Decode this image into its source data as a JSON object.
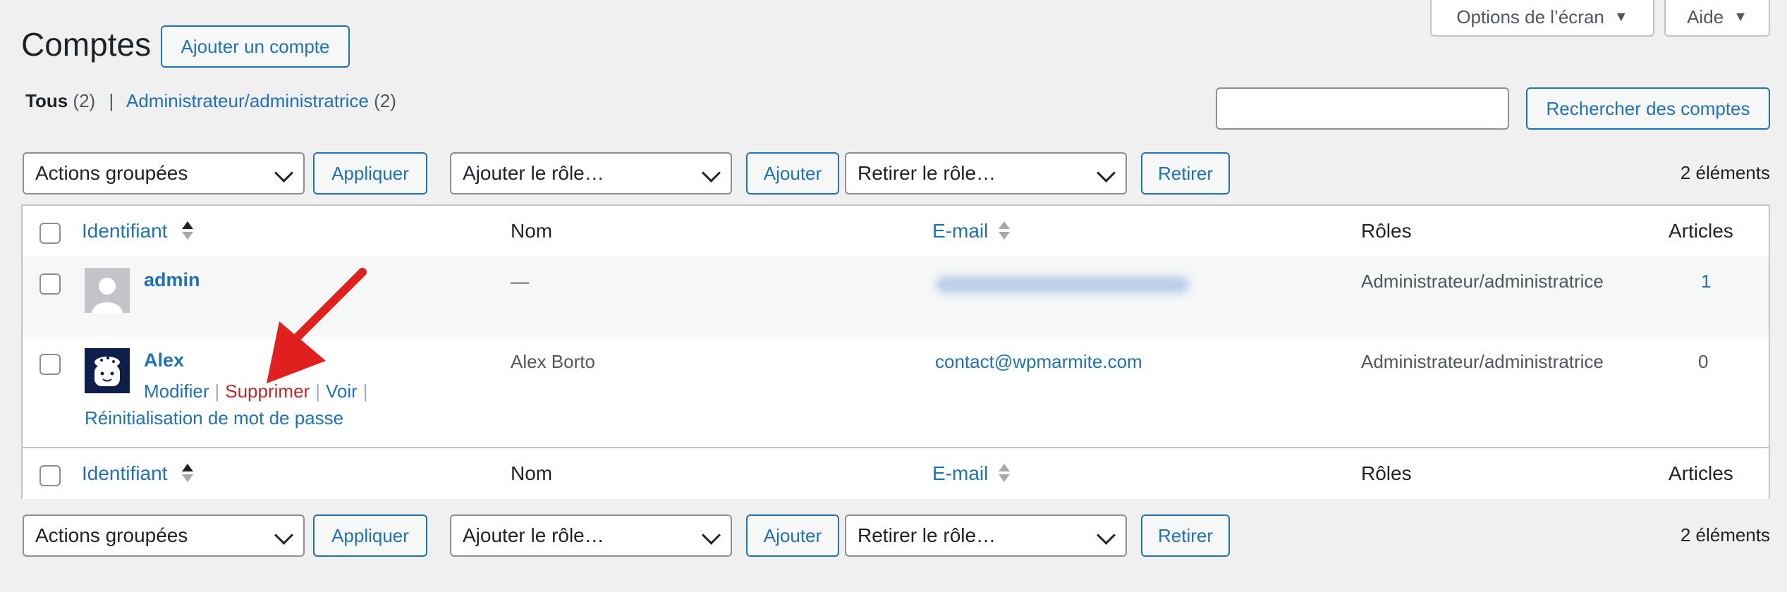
{
  "screen_meta": {
    "options_label": "Options de l’écran",
    "help_label": "Aide"
  },
  "page_title": "Comptes",
  "add_button_label": "Ajouter un compte",
  "views": {
    "all_label": "Tous",
    "all_count": "(2)",
    "separator": "|",
    "admin_label": "Administrateur/administratrice",
    "admin_count": "(2)"
  },
  "search": {
    "value": "",
    "button_label": "Rechercher des comptes"
  },
  "tablenav": {
    "bulk_actions": "Actions groupées",
    "apply": "Appliquer",
    "add_role": "Ajouter le rôle…",
    "add": "Ajouter",
    "remove_role": "Retirer le rôle…",
    "remove": "Retirer",
    "count": "2 éléments"
  },
  "columns": {
    "username": "Identifiant",
    "name": "Nom",
    "email": "E-mail",
    "roles": "Rôles",
    "posts": "Articles"
  },
  "rows": [
    {
      "username": "admin",
      "name": "—",
      "email": "",
      "role": "Administrateur/administratrice",
      "posts": "1"
    },
    {
      "username": "Alex",
      "name": "Alex Borto",
      "email": "contact@wpmarmite.com",
      "role": "Administrateur/administratrice",
      "posts": "0",
      "actions": {
        "edit": "Modifier",
        "delete": "Supprimer",
        "view": "Voir",
        "reset_password": "Réinitialisation de mot de passe",
        "separator": "|"
      }
    }
  ],
  "colors": {
    "accent": "#2271b1",
    "danger": "#b32d2e",
    "annotation_arrow": "#e0201e",
    "background": "#f0f0f1"
  }
}
